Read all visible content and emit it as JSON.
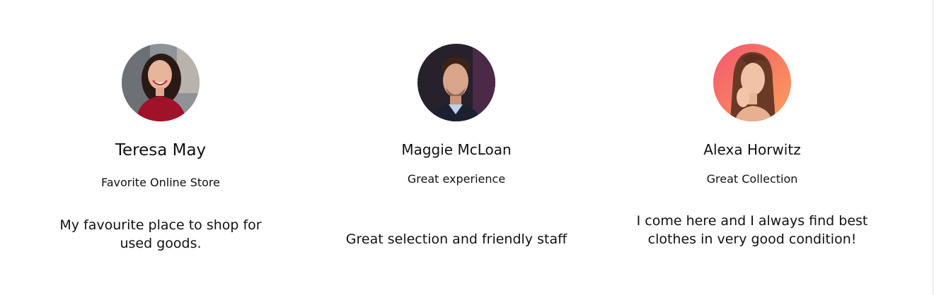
{
  "testimonials": [
    {
      "name": "Teresa May",
      "subtitle": "Favorite Online Store",
      "quote": "My favourite place to shop for used goods.",
      "avatar_icon": "woman-smiling-avatar"
    },
    {
      "name": "Maggie McLoan",
      "subtitle": "Great experience",
      "quote": "Great selection and friendly staff",
      "avatar_icon": "man-portrait-avatar"
    },
    {
      "name": "Alexa Horwitz",
      "subtitle": "Great Collection",
      "quote": "I come here and I always find best clothes in very good condition!",
      "avatar_icon": "woman-portrait-avatar"
    }
  ],
  "colors": {
    "background": "#ffffff",
    "text": "#111111",
    "avatar1_bg": "#8a8f95",
    "avatar2_bg": "#2a2530",
    "avatar3_bg": "#f47a6a"
  }
}
